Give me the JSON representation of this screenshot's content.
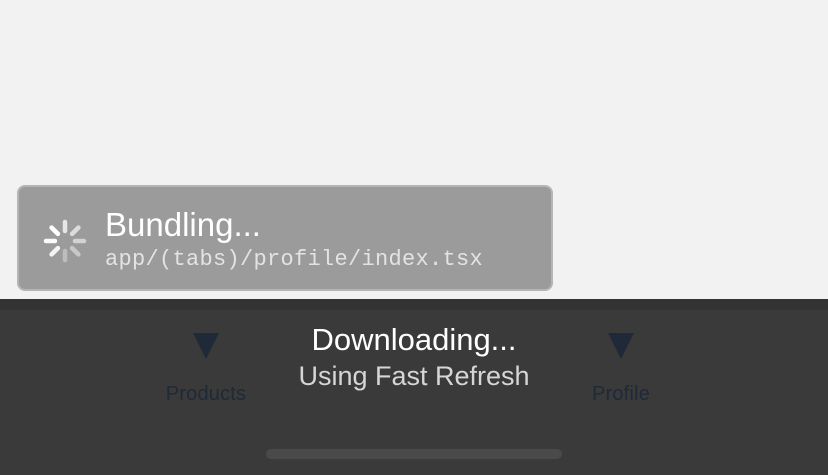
{
  "bundling": {
    "title": "Bundling...",
    "path": "app/(tabs)/profile/index.tsx",
    "spinner_icon": "spinner-icon"
  },
  "download": {
    "title": "Downloading...",
    "subtitle": "Using Fast Refresh"
  },
  "tabs": [
    {
      "label": "Products",
      "icon": "triangle-down-icon"
    },
    {
      "label": "Profile",
      "icon": "triangle-down-icon"
    }
  ],
  "colors": {
    "background": "#f2f2f2",
    "tab_bar": "#3a3a3a",
    "toast": "#9b9b9b",
    "tab_icon": "#1f2937"
  }
}
